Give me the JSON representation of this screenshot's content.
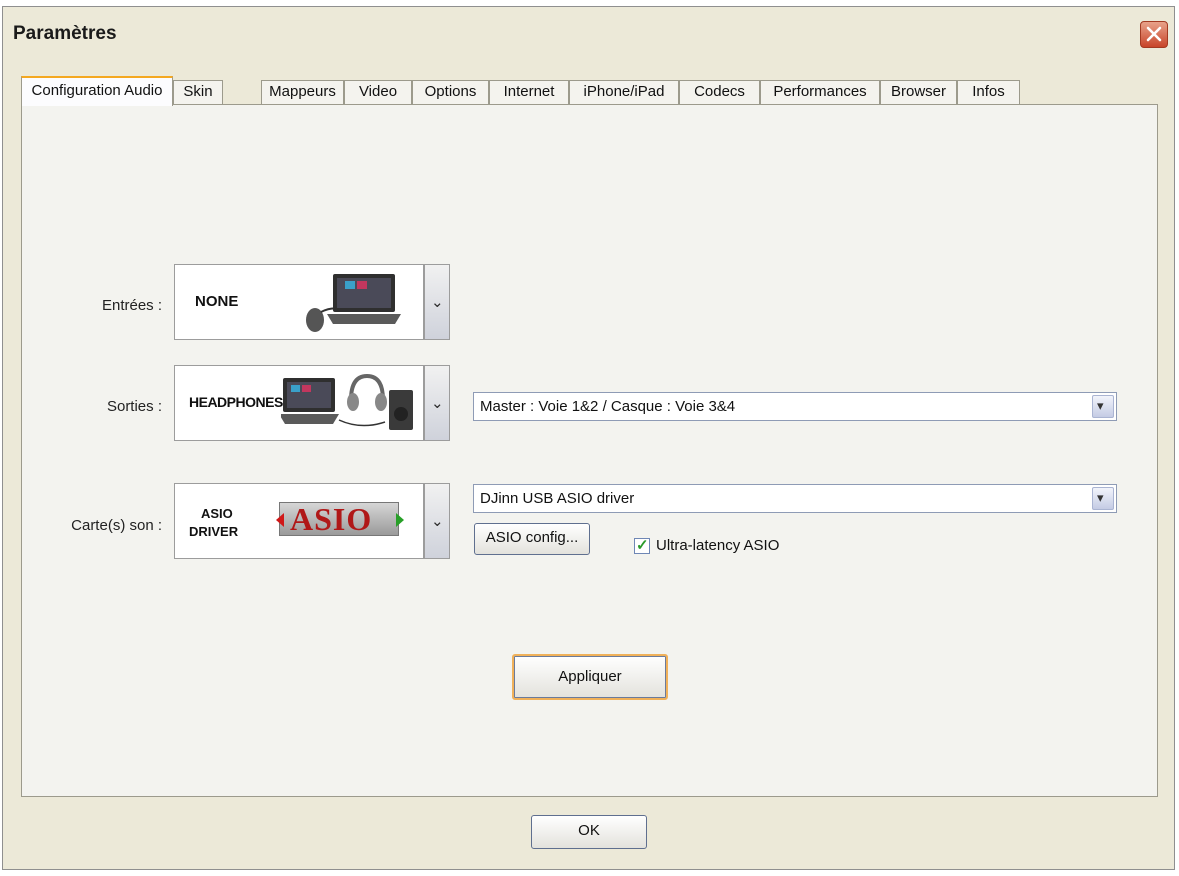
{
  "window": {
    "title": "Paramètres",
    "close_icon": "close-icon"
  },
  "tabs": [
    {
      "label": "Configuration Audio",
      "active": true
    },
    {
      "label": "Skin"
    },
    {
      "label": "Mappeurs"
    },
    {
      "label": "Video"
    },
    {
      "label": "Options"
    },
    {
      "label": "Internet"
    },
    {
      "label": "iPhone/iPad"
    },
    {
      "label": "Codecs"
    },
    {
      "label": "Performances"
    },
    {
      "label": "Browser"
    },
    {
      "label": "Infos"
    }
  ],
  "audio": {
    "inputs": {
      "label": "Entrées :",
      "device": "NONE",
      "icon": "laptop-mouse-icon"
    },
    "outputs": {
      "label": "Sorties :",
      "device": "HEADPHONES",
      "icon": "laptop-headphones-speaker-icon",
      "routing": "Master : Voie 1&2 / Casque : Voie 3&4"
    },
    "soundcard": {
      "label": "Carte(s) son :",
      "device_line1": "ASIO",
      "device_line2": "DRIVER",
      "logo_text": "ASIO",
      "driver": "DJinn USB ASIO driver",
      "config_button": "ASIO config...",
      "ultra_latency_label": "Ultra-latency ASIO",
      "ultra_latency_checked": true
    },
    "apply_button": "Appliquer"
  },
  "ok_button": "OK",
  "colors": {
    "active_tab_accent": "#f4a820",
    "close_red": "#c8452a",
    "check_green": "#2a9a2a"
  }
}
